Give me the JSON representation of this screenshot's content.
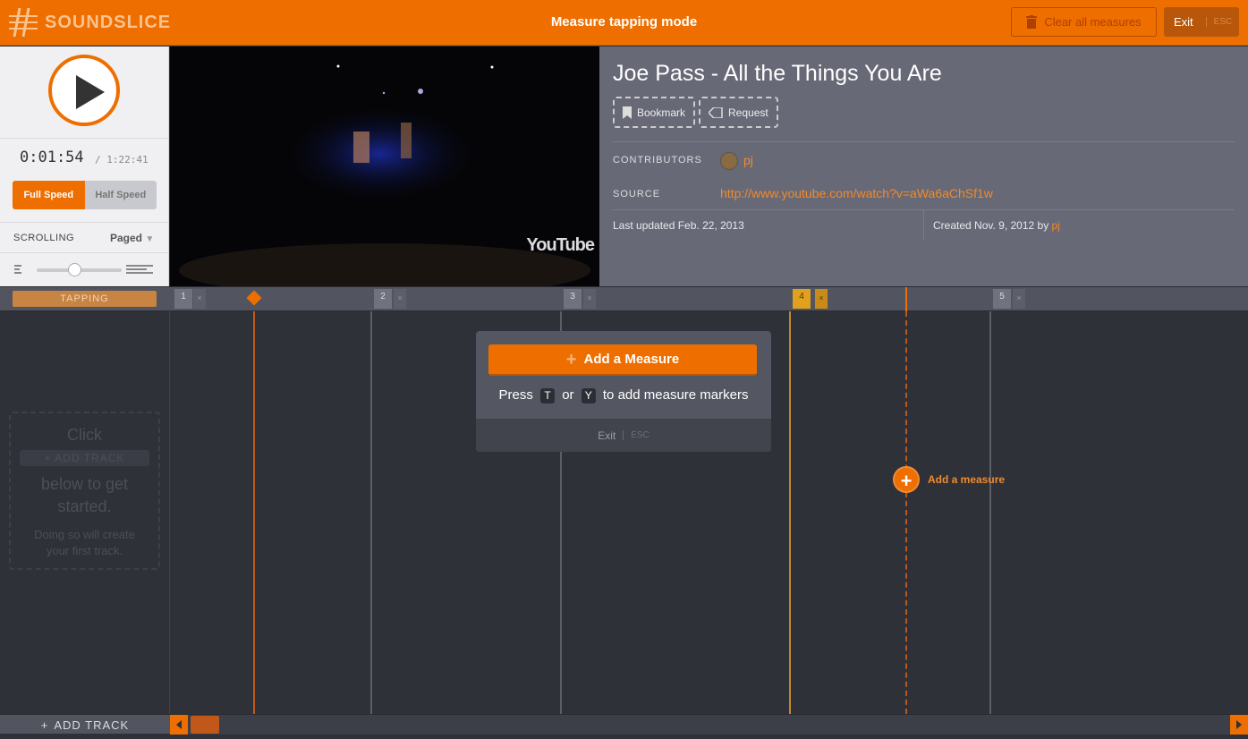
{
  "topbar": {
    "logo_text": "SOUNDSLICE",
    "mode_title": "Measure tapping mode",
    "clear_label": "Clear all measures",
    "exit_label": "Exit",
    "esc_label": "ESC"
  },
  "player": {
    "current_time": "0:01:54",
    "total_time": "/ 1:22:41",
    "full_speed": "Full Speed",
    "half_speed": "Half Speed",
    "scrolling_label": "SCROLLING",
    "scrolling_value": "Paged"
  },
  "video": {
    "watermark": "YouTube"
  },
  "info": {
    "title": "Joe Pass - All the Things You Are",
    "bookmark_label": "Bookmark",
    "request_label": "Request",
    "contributors_label": "CONTRIBUTORS",
    "contributor_name": "pj",
    "source_label": "SOURCE",
    "source_url": "http://www.youtube.com/watch?v=aWa6aChSf1w",
    "last_updated": "Last updated Feb. 22, 2013",
    "created": "Created Nov. 9, 2012 by",
    "created_by": "pj"
  },
  "timeline": {
    "tapping_label": "TAPPING",
    "measures": [
      "1",
      "2",
      "3",
      "4",
      "5"
    ],
    "close_glyph": "×"
  },
  "empty_state": {
    "line1": "Click",
    "button": "+ ADD TRACK",
    "line2": "below to get started.",
    "line3": "Doing so will create your first track."
  },
  "popup": {
    "add_button": "Add a Measure",
    "press": "Press",
    "key_t": "T",
    "or": "or",
    "key_y": "Y",
    "rest": "to add measure markers",
    "exit": "Exit",
    "esc": "ESC"
  },
  "add_measure_hint": "Add a measure",
  "bottom": {
    "add_track": "ADD TRACK"
  },
  "colors": {
    "accent": "#ee6e00",
    "info_bg": "#686977",
    "timeline_bg": "#2f3139"
  }
}
